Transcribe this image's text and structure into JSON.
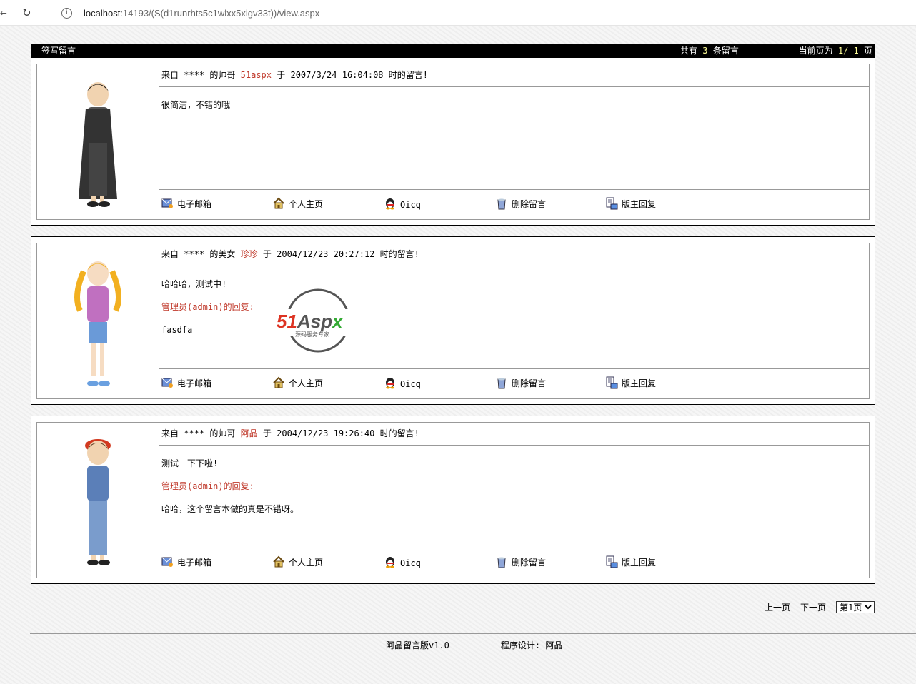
{
  "browser": {
    "url_host": "localhost",
    "url_path": ":14193/(S(d1runrhts5c1wlxx5xigv33t))/view.aspx"
  },
  "topbar": {
    "write_label": "签写留言",
    "total_prefix": "共有",
    "total_count": "3",
    "total_suffix": "条留言",
    "page_prefix": "当前页为",
    "page_current": "1/ 1",
    "page_suffix": "页"
  },
  "messages": [
    {
      "from": "来自",
      "ip": "****",
      "of": "的帅哥",
      "name": "51aspx",
      "at": "于",
      "time": "2007/3/24 16:04:08",
      "tail": "时的留言!",
      "content": "很简洁，不错的哦",
      "reply_label": "",
      "reply": ""
    },
    {
      "from": "来自",
      "ip": "****",
      "of": "的美女",
      "name": "珍珍",
      "at": "于",
      "time": "2004/12/23 20:27:12",
      "tail": "时的留言!",
      "content": "哈哈哈，测试中!",
      "reply_label": "管理员(admin)的回复:",
      "reply": "fasdfa"
    },
    {
      "from": "来自",
      "ip": "****",
      "of": "的帅哥",
      "name": "阿晶",
      "at": "于",
      "time": "2004/12/23 19:26:40",
      "tail": "时的留言!",
      "content": "测试一下下啦!",
      "reply_label": "管理员(admin)的回复:",
      "reply": "哈哈，这个留言本做的真是不错呀。"
    }
  ],
  "actions": {
    "email": "电子邮箱",
    "homepage": "个人主页",
    "oicq": "Oicq",
    "delete": "删除留言",
    "reply": "版主回复"
  },
  "watermark": {
    "logo": "51Aspx",
    "tagline": "源码服务专家"
  },
  "pager": {
    "prev": "上一页",
    "next": "下一页",
    "selected": "第1页"
  },
  "footer": {
    "product": "阿晶留言版v1.0",
    "designer": "程序设计: 阿晶"
  },
  "colors": {
    "name": "#c0392b",
    "highlight": "#ffff99"
  }
}
